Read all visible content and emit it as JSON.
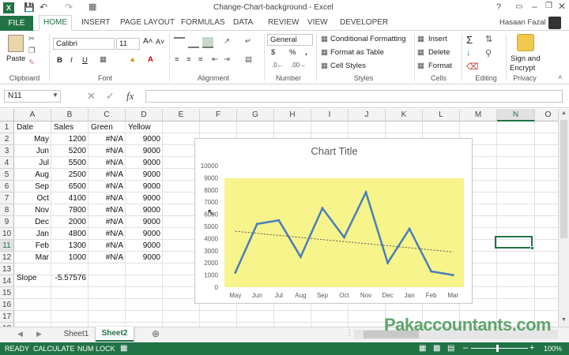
{
  "title_bar": {
    "text": "Change-Chart-background - Excel",
    "user": "Hasaan Fazal"
  },
  "tabs": [
    "FILE",
    "HOME",
    "INSERT",
    "PAGE LAYOUT",
    "FORMULAS",
    "DATA",
    "REVIEW",
    "VIEW",
    "DEVELOPER"
  ],
  "ribbon": {
    "paste": "Paste",
    "font_name": "Calibri",
    "font_size": "11",
    "number_format": "General",
    "conditional": "Conditional Formatting",
    "format_table": "Format as Table",
    "cell_styles": "Cell Styles",
    "insert": "Insert",
    "delete": "Delete",
    "format": "Format",
    "sign1": "Sign and",
    "sign2": "Encrypt",
    "groups": [
      "Clipboard",
      "Font",
      "Alignment",
      "Number",
      "Styles",
      "Cells",
      "Editing",
      "Privacy"
    ]
  },
  "formula_bar": {
    "name_box": "N11",
    "fx": "fx",
    "value": ""
  },
  "columns": [
    "A",
    "B",
    "C",
    "D",
    "E",
    "F",
    "G",
    "H",
    "I",
    "J",
    "K",
    "L",
    "M",
    "N",
    "O"
  ],
  "rows": [
    "1",
    "2",
    "3",
    "4",
    "5",
    "6",
    "7",
    "8",
    "9",
    "10",
    "11",
    "12",
    "13",
    "14",
    "15",
    "16",
    "17",
    "18"
  ],
  "headers": [
    "Date",
    "Sales",
    "Green",
    "Yellow"
  ],
  "data": [
    [
      "May",
      "1200",
      "#N/A",
      "9000"
    ],
    [
      "Jun",
      "5200",
      "#N/A",
      "9000"
    ],
    [
      "Jul",
      "5500",
      "#N/A",
      "9000"
    ],
    [
      "Aug",
      "2500",
      "#N/A",
      "9000"
    ],
    [
      "Sep",
      "6500",
      "#N/A",
      "9000"
    ],
    [
      "Oct",
      "4100",
      "#N/A",
      "9000"
    ],
    [
      "Nov",
      "7800",
      "#N/A",
      "9000"
    ],
    [
      "Dec",
      "2000",
      "#N/A",
      "9000"
    ],
    [
      "Jan",
      "4800",
      "#N/A",
      "9000"
    ],
    [
      "Feb",
      "1300",
      "#N/A",
      "9000"
    ],
    [
      "Mar",
      "1000",
      "#N/A",
      "9000"
    ]
  ],
  "slope_label": "Slope",
  "slope_value": "-5.57576",
  "sheets": [
    "Sheet1",
    "Sheet2"
  ],
  "status": {
    "ready": "READY",
    "calc": "CALCULATE",
    "numlock": "NUM LOCK",
    "zoom": "100%"
  },
  "watermark": "Pakaccountants.com",
  "colors": {
    "excel_green": "#217346",
    "plot_area": "#f7f48b",
    "line": "#4a7ebb"
  },
  "chart_data": {
    "type": "line",
    "title": "Chart Title",
    "categories": [
      "May",
      "Jun",
      "Jul",
      "Aug",
      "Sep",
      "Oct",
      "Nov",
      "Dec",
      "Jan",
      "Feb",
      "Mar"
    ],
    "series": [
      {
        "values": [
          1200,
          5200,
          5500,
          2500,
          6500,
          4100,
          7800,
          2000,
          4800,
          1300,
          1000
        ]
      }
    ],
    "trendline": {
      "type": "linear",
      "style": "dotted",
      "start": 4600,
      "end": 2900
    },
    "ylim": [
      0,
      10000
    ],
    "yticks": [
      "0",
      "1000",
      "2000",
      "3000",
      "4000",
      "5000",
      "6000",
      "7000",
      "8000",
      "9000",
      "10000"
    ],
    "grid": false,
    "legend": "none"
  }
}
